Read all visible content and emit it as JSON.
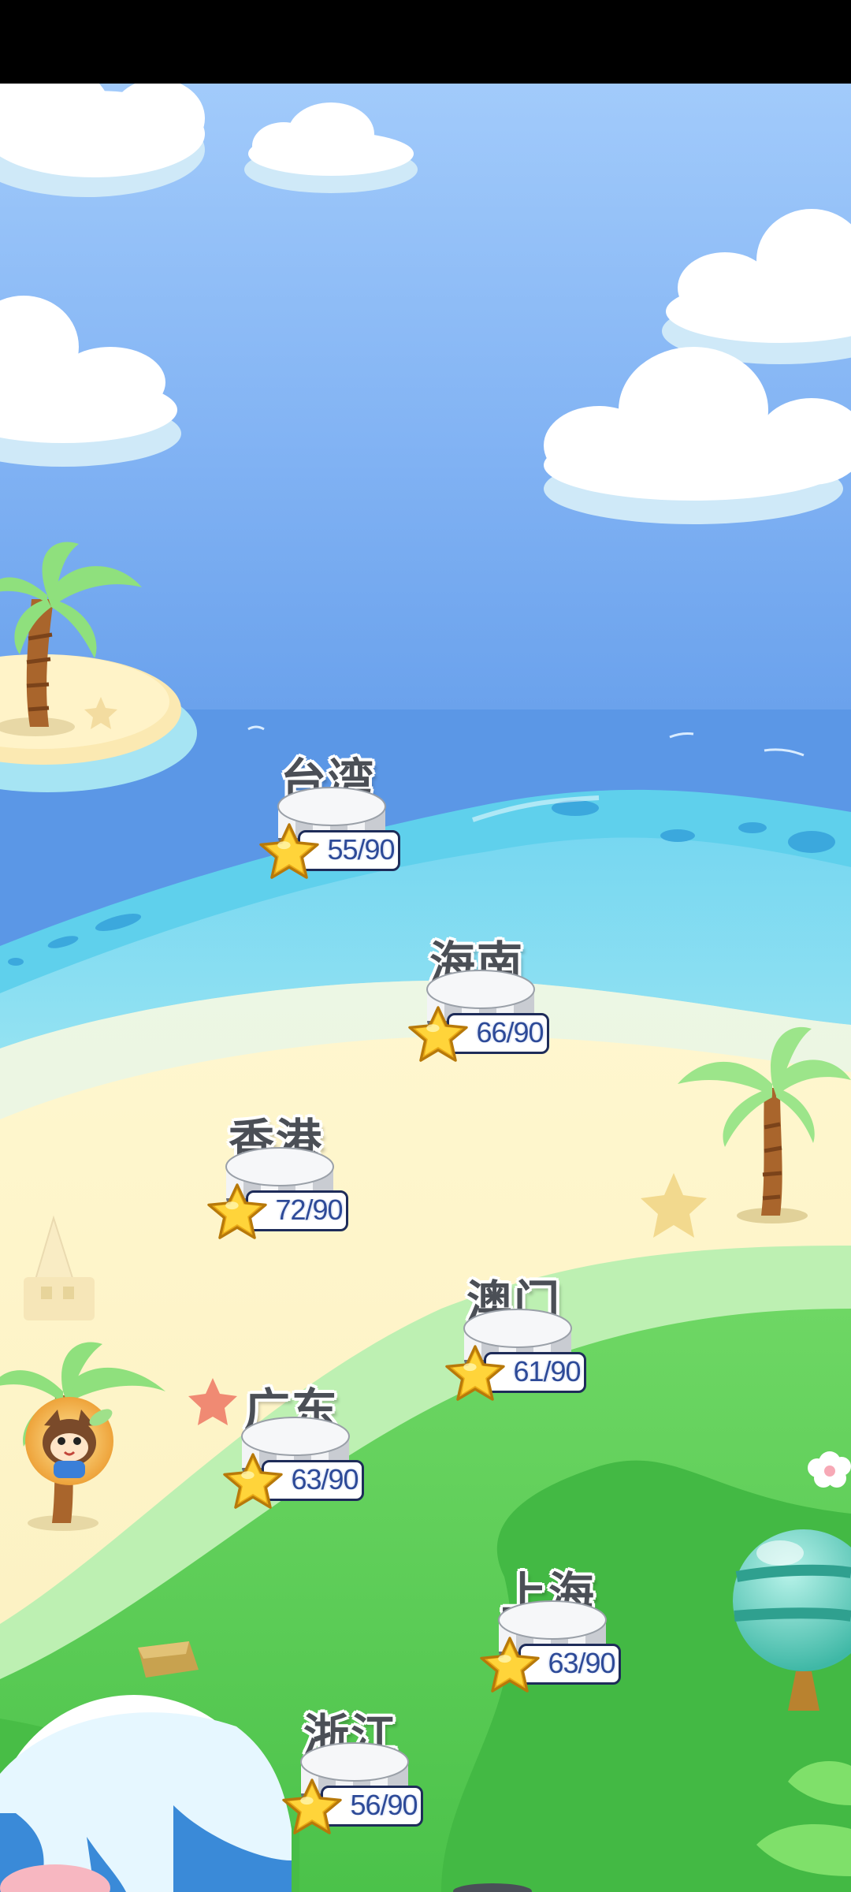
{
  "levels": [
    {
      "name": "台湾",
      "score": "55/90"
    },
    {
      "name": "海南",
      "score": "66/90"
    },
    {
      "name": "香港",
      "score": "72/90"
    },
    {
      "name": "澳门",
      "score": "61/90"
    },
    {
      "name": "广东",
      "score": "63/90"
    },
    {
      "name": "上海",
      "score": "63/90"
    },
    {
      "name": "浙江",
      "score": "56/90"
    }
  ],
  "icons": {
    "star": "star-icon",
    "player": "player-avatar-icon",
    "palm": "palm-tree-icon"
  }
}
